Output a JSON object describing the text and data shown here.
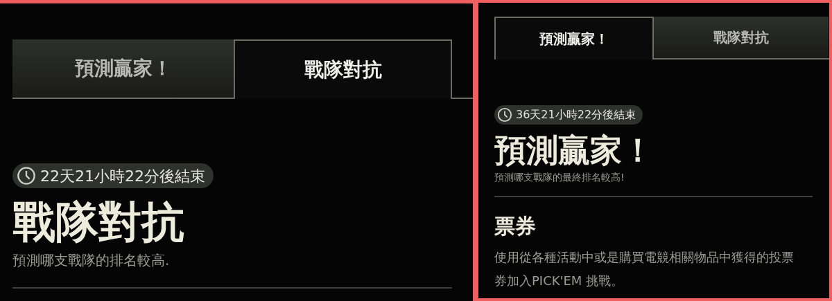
{
  "panels": [
    {
      "tabs": [
        {
          "label": "預測贏家！",
          "selected": false
        },
        {
          "label": "戰隊對抗",
          "selected": true
        }
      ],
      "timer": "22天21小時22分後結束",
      "title": "戰隊對抗",
      "subtitle": "預測哪支戰隊的排名較高."
    },
    {
      "tabs": [
        {
          "label": "預測贏家！",
          "selected": true
        },
        {
          "label": "戰隊對抗",
          "selected": false
        }
      ],
      "timer": "36天21小時22分後結束",
      "title": "預測贏家！",
      "subtitle": "預測哪支戰隊的最終排名較高!",
      "section": {
        "title": "票券",
        "body": "使用從各種活動中或是購買電競相關物品中獲得的投票券加入PICK'EM 挑戰。"
      }
    }
  ]
}
